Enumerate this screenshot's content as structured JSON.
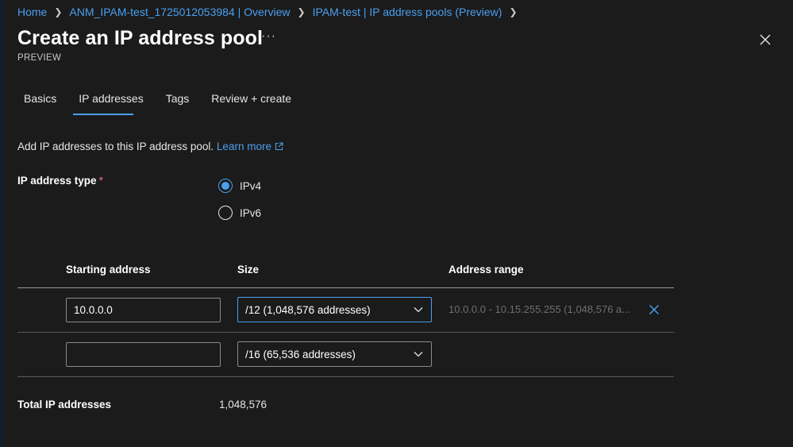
{
  "breadcrumb": [
    {
      "label": "Home"
    },
    {
      "label": "ANM_IPAM-test_1725012053984 | Overview"
    },
    {
      "label": "IPAM-test | IP address pools (Preview)"
    }
  ],
  "page": {
    "title": "Create an IP address pool",
    "more_label": "···",
    "subtitle": "PREVIEW"
  },
  "tabs": [
    {
      "label": "Basics",
      "active": false
    },
    {
      "label": "IP addresses",
      "active": true
    },
    {
      "label": "Tags",
      "active": false
    },
    {
      "label": "Review + create",
      "active": false
    }
  ],
  "description": {
    "text": "Add IP addresses to this IP address pool.",
    "link_label": "Learn more"
  },
  "ip_type": {
    "label": "IP address type",
    "required_mark": "*",
    "options": [
      {
        "label": "IPv4",
        "selected": true
      },
      {
        "label": "IPv6",
        "selected": false
      }
    ]
  },
  "table": {
    "headers": [
      "Starting address",
      "Size",
      "Address range"
    ],
    "rows": [
      {
        "start": "10.0.0.0",
        "size": "/12 (1,048,576 addresses)",
        "range": "10.0.0.0 - 10.15.255.255 (1,048,576 a..."
      },
      {
        "start": "",
        "size": "/16 (65,536 addresses)",
        "range": ""
      }
    ]
  },
  "total": {
    "label": "Total IP addresses",
    "value": "1,048,576"
  },
  "colors": {
    "accent": "#4aa0f0",
    "background": "#1b1b1b",
    "required": "#f1707b"
  },
  "icons": [
    "chevron-right-icon",
    "close-icon",
    "external-link-icon",
    "chevron-down-icon",
    "delete-x-icon"
  ]
}
